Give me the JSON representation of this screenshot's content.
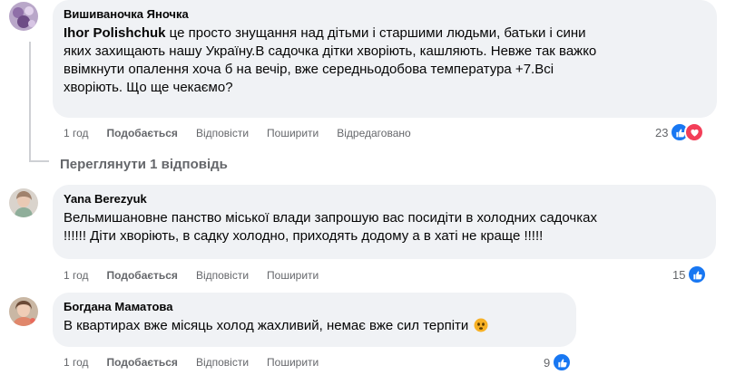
{
  "comments": [
    {
      "author": "Вишиваночка Яночка",
      "mention": "Ihor Polishchuk",
      "text_lines": [
        " це просто знущання над дітьми і старшими людьми, батьки і сини",
        "яких захищають нашу Україну.В садочка дітки хворіють, кашляють. Невже так важко",
        "ввімкнути опалення хоча б на вечір, вже середньодобова температура +7.Всі",
        "хворіють. Що ще чекаємо?"
      ],
      "time": "1 год",
      "like_label": "Подобається",
      "reply_label": "Відповісти",
      "share_label": "Поширити",
      "edited_label": "Відредаговано",
      "reaction_count": "23",
      "reaction_icons": [
        "like-icon",
        "love-icon"
      ]
    },
    {
      "author": "Yana Berezyuk",
      "text_lines": [
        "Вельмишановне панство міської влади запрошую вас посидіти в холодних садочках",
        "!!!!!! Діти хворіють, в садку холодно, приходять додому а в хаті не краще !!!!!"
      ],
      "time": "1 год",
      "like_label": "Подобається",
      "reply_label": "Відповісти",
      "share_label": "Поширити",
      "reaction_count": "15",
      "reaction_icons": [
        "like-icon"
      ]
    },
    {
      "author": "Богдана Маматова",
      "text_lines": [
        "В квартирах вже місяць холод жахливий, немає вже сил терпіти"
      ],
      "emoji": "sad-face-emoji",
      "time": "1 год",
      "like_label": "Подобається",
      "reply_label": "Відповісти",
      "share_label": "Поширити",
      "reaction_count": "9",
      "reaction_icons": [
        "like-icon"
      ]
    }
  ],
  "view_replies_label": "Переглянути 1 відповідь",
  "colors": {
    "bubble": "#f0f2f5",
    "secondary_text": "#65676b",
    "like": "#1877f2",
    "love": "#f33e58"
  }
}
